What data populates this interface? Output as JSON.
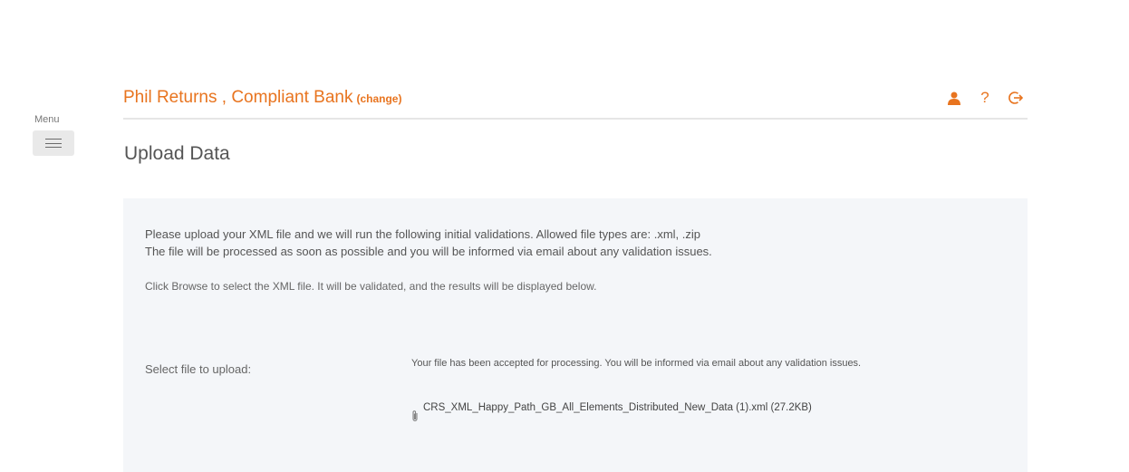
{
  "menu": {
    "label": "Menu"
  },
  "header": {
    "title": "Phil Returns , Compliant Bank",
    "change_label": "(change)",
    "icons": [
      "user-icon",
      "help-icon",
      "logout-icon"
    ],
    "help_glyph": "?",
    "accent_color": "#e8741f"
  },
  "page": {
    "title": "Upload Data"
  },
  "panel": {
    "intro_line1": "Please upload your XML file and we will run the following initial validations. Allowed file types are: .xml, .zip",
    "intro_line2": "The file will be processed as soon as possible and you will be informed via email about any validation issues.",
    "instruction": "Click Browse to select the XML file. It will be validated, and the results will be displayed below.",
    "upload_label": "Select file to upload:",
    "upload_status": "Your file has been accepted for processing. You will be informed via email about any validation issues.",
    "file_name": "CRS_XML_Happy_Path_GB_All_Elements_Distributed_New_Data (1).xml (27.2KB)"
  }
}
